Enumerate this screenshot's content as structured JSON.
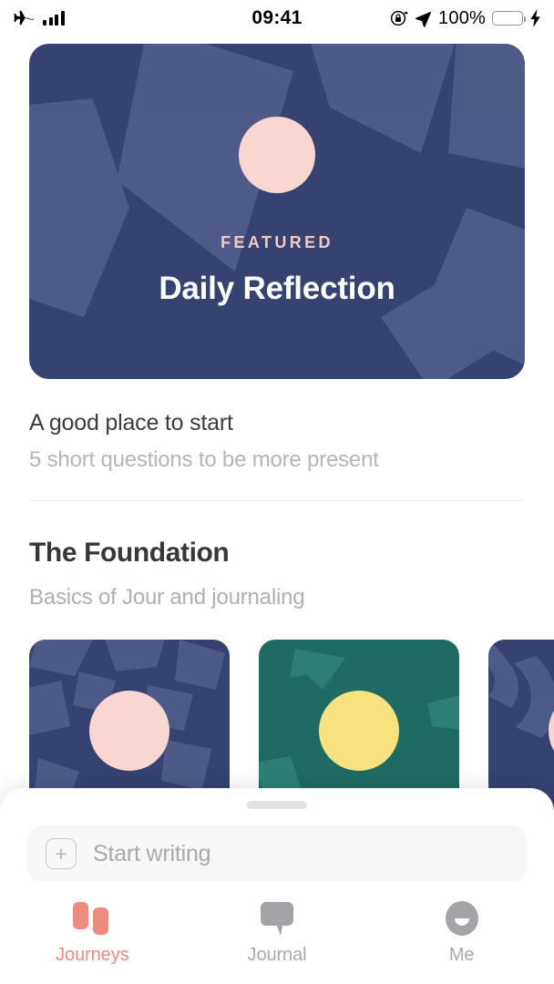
{
  "statusbar": {
    "airplane_icon": "airplane-icon",
    "signal_icon": "signal-bars-icon",
    "time": "09:41",
    "rotation_lock_icon": "rotation-lock-icon",
    "location_icon": "location-arrow-icon",
    "battery_percent": "100%",
    "battery_icon": "battery-icon",
    "charging_icon": "lightning-bolt-icon",
    "battery_color": "#4cd964"
  },
  "hero": {
    "kicker": "FEATURED",
    "title": "Daily Reflection",
    "bg_color": "#364270",
    "shape_color": "#5d6a96",
    "circle_color": "#fad6d0",
    "kicker_color": "#f3c9c4"
  },
  "start_row": {
    "title": "A good place to start",
    "subtitle": "5 short questions to be more present"
  },
  "section": {
    "title": "The Foundation",
    "subtitle": "Basics of Jour and journaling"
  },
  "cards": [
    {
      "bg": "#364270",
      "shape": "#5d6a96",
      "dot": "#fad6d0",
      "name": "journey-card-1"
    },
    {
      "bg": "#1f6b64",
      "shape": "#2d7d74",
      "dot": "#f7e27f",
      "name": "journey-card-2"
    },
    {
      "bg": "#364270",
      "shape": "#5d6a96",
      "dot": "#fad6d0",
      "name": "journey-card-3"
    }
  ],
  "sheet": {
    "handle": "drag-handle",
    "compose_placeholder": "Start writing",
    "add_label": "+"
  },
  "tabs": [
    {
      "label": "Journeys",
      "icon": "journeys-icon",
      "active": true
    },
    {
      "label": "Journal",
      "icon": "speech-bubble-icon",
      "active": false
    },
    {
      "label": "Me",
      "icon": "smiley-face-icon",
      "active": false
    }
  ],
  "colors": {
    "accent": "#ee8b7f",
    "navy": "#364270",
    "teal": "#1f6b64",
    "inactive": "#a9a9ae"
  }
}
